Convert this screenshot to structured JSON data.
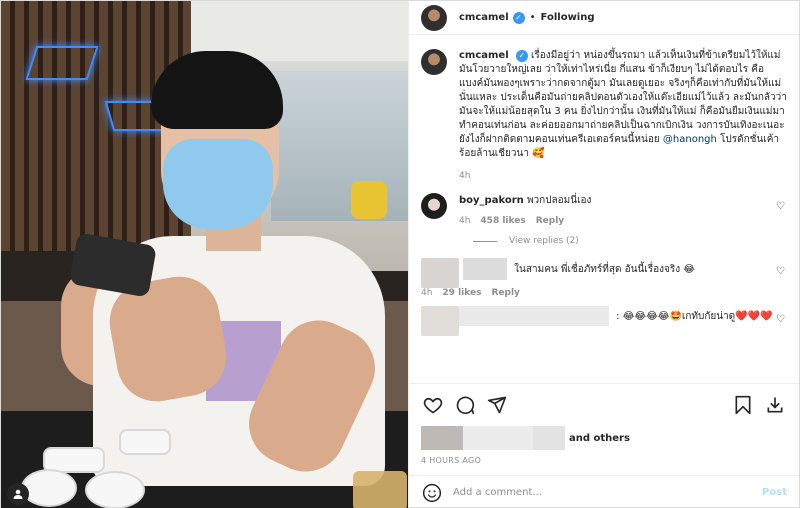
{
  "post": {
    "author": "cmcamel",
    "follow_state": "Following",
    "separator": "•"
  },
  "caption": {
    "username": "cmcamel",
    "text": "เรื่องมีอยู่ว่า หน่องขึ้นรถมา แล้วเห็นเงินที่ข้าเตรียมไว้ให้แม่ มันโวยวายใหญ่เลย ว่าให้เท่าไหร่เนี่ย กี่แสน ข้าก็เงียบๆ ไม่ได้ตอบไร คือแบงค์มันพองๆเพราะว่ากดจากตู้มา มันเลยดูเยอะ จริงๆก็คือเท่ากับที่มันให้แม่นั่นแหละ ประเด็นคือมันถ่ายคลิปตอนตัวเองให้แต๊ะเอียแม่ไว้แล้ว ละมันกลัวว่ามันจะให้แม่น้อยสุดใน 3 คน ยิ่งไปกว่านั้น เงินที่มันให้แม่ ก็คือมันยืมเงินแม่มาทำคอนเท่นก่อน ละค่อยออกมาถ่ายคลิปเป็นฉากเบิกเงิน วงการบันเทิงอะเนอะ ยังไงก็ฝากติดตามคอนเท่นครีเอเตอร์คนนี้หน่อย",
    "mention": "@hanongh",
    "tail": " โปรดักชั่นเค้าร้อยล้านเชียวนา 🥰",
    "time": "4h"
  },
  "comments": [
    {
      "username": "boy_pakorn",
      "text": "พวกปลอมนี่เอง",
      "time": "4h",
      "likes": "458 likes",
      "reply": "Reply",
      "view_replies": "View replies (2)"
    },
    {
      "username": "",
      "text": "ในสามคน พี่เชื่อภัทร์ที่สุด อันนี้เรื่องจริง 😂",
      "time": "4h",
      "likes": "29 likes",
      "reply": "Reply"
    },
    {
      "username": "",
      "text": ": 😂😂😂😂🤩เกทับกัยน่าดู❤️❤️❤️"
    }
  ],
  "likes": {
    "suffix": "and others"
  },
  "timestamp": "4 HOURS AGO",
  "composer": {
    "placeholder": "Add a comment...",
    "post_label": "Post"
  },
  "icons": {
    "verified": "verified-badge-icon",
    "heart": "heart-icon",
    "comment": "comment-icon",
    "share": "share-icon",
    "save": "bookmark-icon",
    "download": "download-icon",
    "emoji": "emoji-icon",
    "tag": "person-tag-icon"
  },
  "colors": {
    "link": "#00376b",
    "verified": "#3897f0",
    "post_disabled": "#b2dffc",
    "muted": "#8e8e8e"
  }
}
